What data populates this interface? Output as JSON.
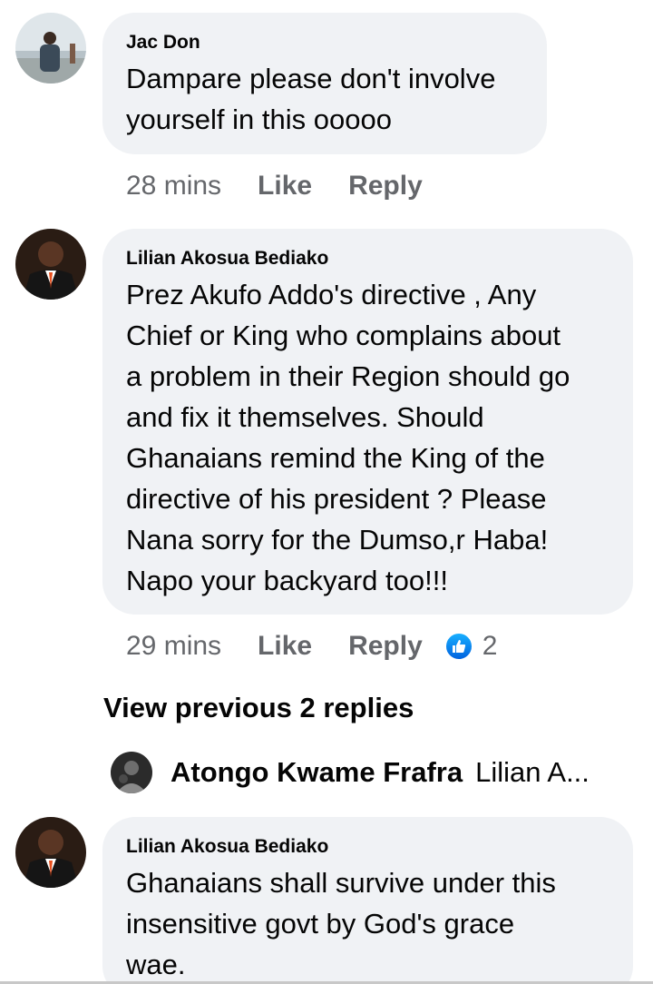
{
  "comments": [
    {
      "author": "Jac Don",
      "text": "Dampare please don't involve\nyourself in this ooooo",
      "time": "28 mins",
      "like_label": "Like",
      "reply_label": "Reply"
    },
    {
      "author": "Lilian Akosua Bediako",
      "text": "Prez Akufo Addo's directive , Any\nChief or King  who complains about\na problem in their Region should go\nand fix it themselves. Should\nGhanaians remind the King of the\ndirective of his president ? Please\nNana sorry for the Dumso,r Haba!\nNapo your backyard too!!!",
      "time": "29 mins",
      "like_label": "Like",
      "reply_label": "Reply",
      "reaction_count": "2",
      "reaction_icon": "thumbs-up-icon"
    },
    {
      "author": "Lilian Akosua Bediako",
      "text": "Ghanaians shall survive under this\ninsensitive govt by God's grace\nwae."
    }
  ],
  "view_previous": "View previous 2 replies",
  "reply_preview": {
    "author": "Atongo Kwame Frafra",
    "preview": "Lilian A..."
  },
  "colors": {
    "bubble": "#f0f2f5",
    "meta_text": "#65676b",
    "like_badge": "#1877f2"
  }
}
